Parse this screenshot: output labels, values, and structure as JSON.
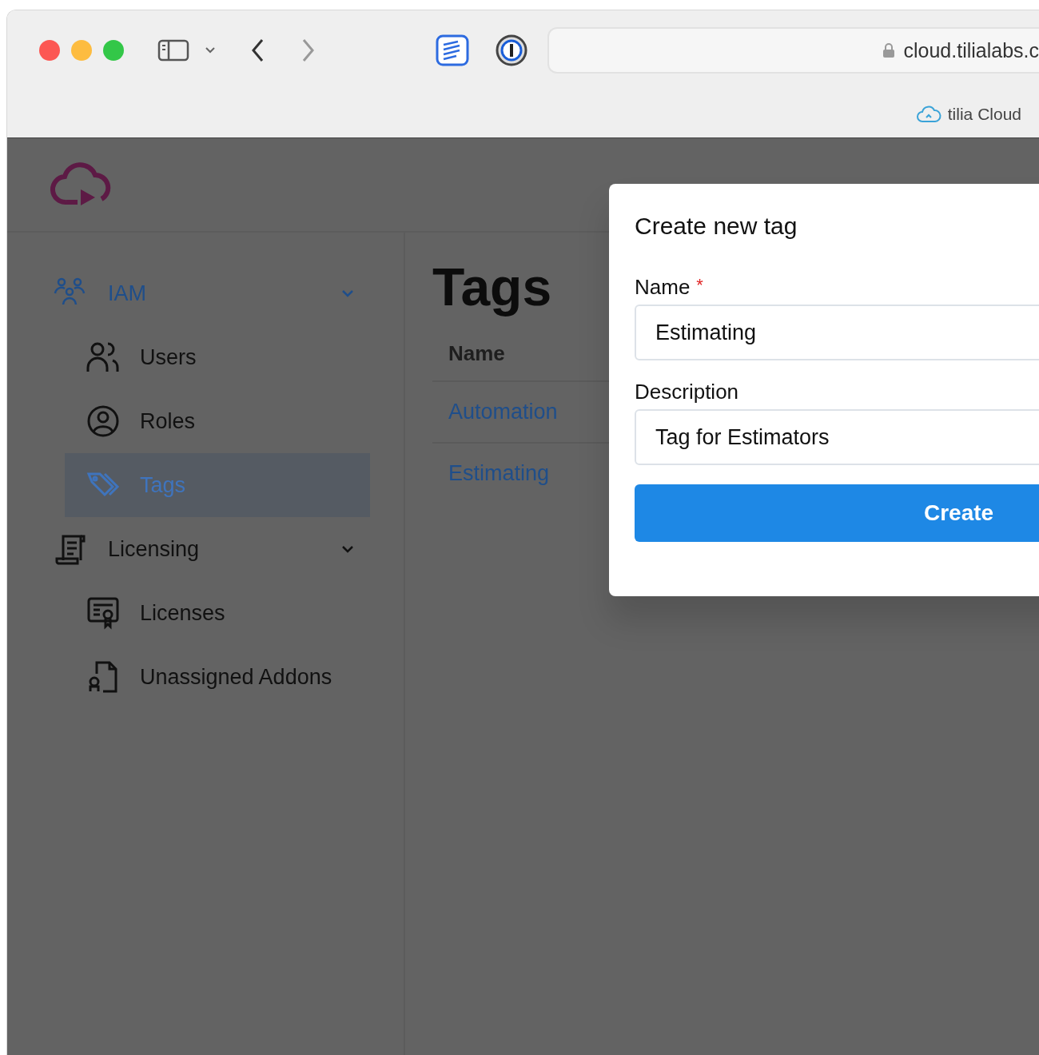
{
  "browser": {
    "address": "cloud.tilialabs.c",
    "tabs": [
      {
        "label": "tilia Cloud",
        "selected": true
      }
    ]
  },
  "sidebar": {
    "groups": [
      {
        "label": "IAM",
        "selected": true,
        "expanded": true,
        "children": [
          {
            "label": "Users",
            "selected": false
          },
          {
            "label": "Roles",
            "selected": false
          },
          {
            "label": "Tags",
            "selected": true
          }
        ]
      },
      {
        "label": "Licensing",
        "selected": false,
        "expanded": true,
        "children": [
          {
            "label": "Licenses",
            "selected": false
          },
          {
            "label": "Unassigned Addons",
            "selected": false
          }
        ]
      }
    ]
  },
  "page": {
    "title": "Tags",
    "table": {
      "columns": [
        "Name"
      ],
      "rows": [
        [
          "Automation"
        ],
        [
          "Estimating"
        ]
      ]
    }
  },
  "dialog": {
    "title": "Create new tag",
    "fields": [
      {
        "label": "Name",
        "required_mark": "*",
        "value": "Estimating"
      },
      {
        "label": "Description",
        "value": "Tag for Estimators"
      }
    ],
    "button": "Create"
  }
}
